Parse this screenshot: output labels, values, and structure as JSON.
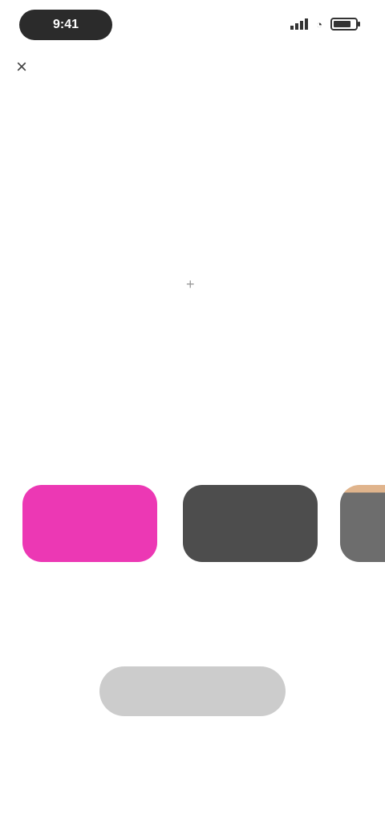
{
  "status_bar": {
    "time": "9:41"
  },
  "nav": {
    "close_glyph": "×",
    "title": ""
  },
  "page": {
    "title": "",
    "subtitle": ""
  },
  "empty_state": {
    "icon": "plus-icon",
    "text": ""
  },
  "section": {
    "label": ""
  },
  "cards": [
    {
      "caption": ""
    },
    {
      "caption": ""
    },
    {
      "caption": ""
    }
  ],
  "actions": {
    "primary_label": "",
    "secondary_label": ""
  },
  "colors": {
    "pink": "#ec38b4",
    "dark": "#4d4d4d",
    "disabled_button": "#cccccc"
  }
}
